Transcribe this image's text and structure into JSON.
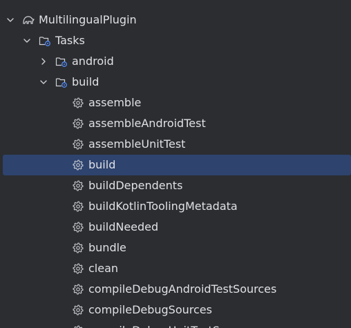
{
  "tree": {
    "root": {
      "label": "MultilingualPlugin",
      "icon": "elephant-icon",
      "expanded": true
    },
    "tasks": {
      "label": "Tasks",
      "icon": "task-folder-icon",
      "expanded": true
    },
    "android": {
      "label": "android",
      "icon": "task-folder-icon",
      "expanded": false
    },
    "build_group": {
      "label": "build",
      "icon": "task-folder-icon",
      "expanded": true
    },
    "tasks_list": [
      {
        "label": "assemble",
        "icon": "gear-icon"
      },
      {
        "label": "assembleAndroidTest",
        "icon": "gear-icon"
      },
      {
        "label": "assembleUnitTest",
        "icon": "gear-icon"
      },
      {
        "label": "build",
        "icon": "gear-icon",
        "selected": true
      },
      {
        "label": "buildDependents",
        "icon": "gear-icon"
      },
      {
        "label": "buildKotlinToolingMetadata",
        "icon": "gear-icon"
      },
      {
        "label": "buildNeeded",
        "icon": "gear-icon"
      },
      {
        "label": "bundle",
        "icon": "gear-icon"
      },
      {
        "label": "clean",
        "icon": "gear-icon"
      },
      {
        "label": "compileDebugAndroidTestSources",
        "icon": "gear-icon"
      },
      {
        "label": "compileDebugSources",
        "icon": "gear-icon"
      },
      {
        "label": "compileDebugUnitTestSources",
        "icon": "gear-icon"
      }
    ]
  },
  "colors": {
    "background": "#2b2d30",
    "selection": "#2e436e",
    "text": "#dfe1e5",
    "icon": "#ced0d6",
    "accent": "#548af7"
  }
}
